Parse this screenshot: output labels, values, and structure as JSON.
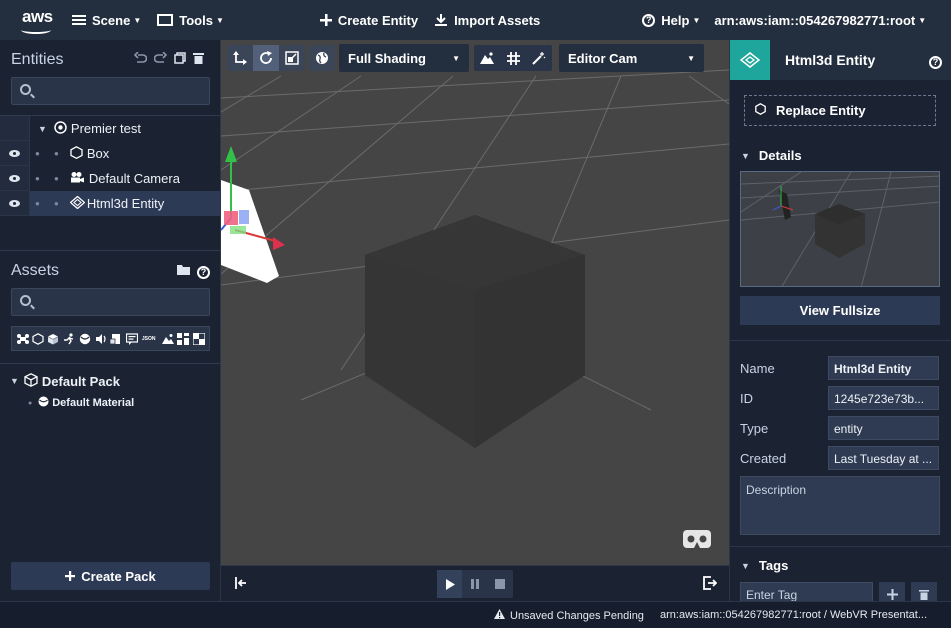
{
  "topbar": {
    "logo": "aws",
    "scene_label": "Scene",
    "tools_label": "Tools",
    "create_entity_label": "Create Entity",
    "import_assets_label": "Import Assets",
    "help_label": "Help",
    "account_label": "arn:aws:iam::054267982771:root"
  },
  "entities_panel": {
    "title": "Entities",
    "search_placeholder": "",
    "tree": [
      {
        "label": "Premier test",
        "icon": "scene-icon"
      },
      {
        "label": "Box",
        "icon": "box-icon"
      },
      {
        "label": "Default Camera",
        "icon": "camera-icon"
      },
      {
        "label": "Html3d Entity",
        "icon": "html3d-icon"
      }
    ]
  },
  "assets_panel": {
    "title": "Assets",
    "search_placeholder": "",
    "filter_icons": [
      "entity-icon",
      "geometry-icon",
      "model-icon",
      "animation-icon",
      "material-icon",
      "audio-icon",
      "script-icon",
      "text-icon",
      "json-icon",
      "image-icon",
      "environment-icon",
      "texture-icon"
    ],
    "json_label": "JSON",
    "packs": [
      {
        "label": "Default Pack",
        "children": [
          "Default Material"
        ]
      }
    ],
    "create_pack_label": "Create Pack"
  },
  "viewport_toolbar": {
    "shading_label": "Full Shading",
    "camera_label": "Editor Cam"
  },
  "inspector": {
    "title": "Html3d Entity",
    "replace_label": "Replace Entity",
    "details_label": "Details",
    "view_fullsize_label": "View Fullsize",
    "properties": [
      {
        "label": "Name",
        "value": "Html3d Entity"
      },
      {
        "label": "ID",
        "value": "1245e723e73b..."
      },
      {
        "label": "Type",
        "value": "entity"
      },
      {
        "label": "Created",
        "value": "Last Tuesday at ..."
      }
    ],
    "description_placeholder": "Description",
    "tags_label": "Tags",
    "tag_placeholder": "Enter Tag"
  },
  "statusbar": {
    "warning": "Unsaved Changes Pending",
    "info": "arn:aws:iam::054267982771:root  /  WebVR Presentat..."
  },
  "colors": {
    "accent_teal": "#1ea59c",
    "nav_bg": "#232f3e",
    "panel_bg": "#1b2333",
    "viewport_bg": "#454545"
  }
}
